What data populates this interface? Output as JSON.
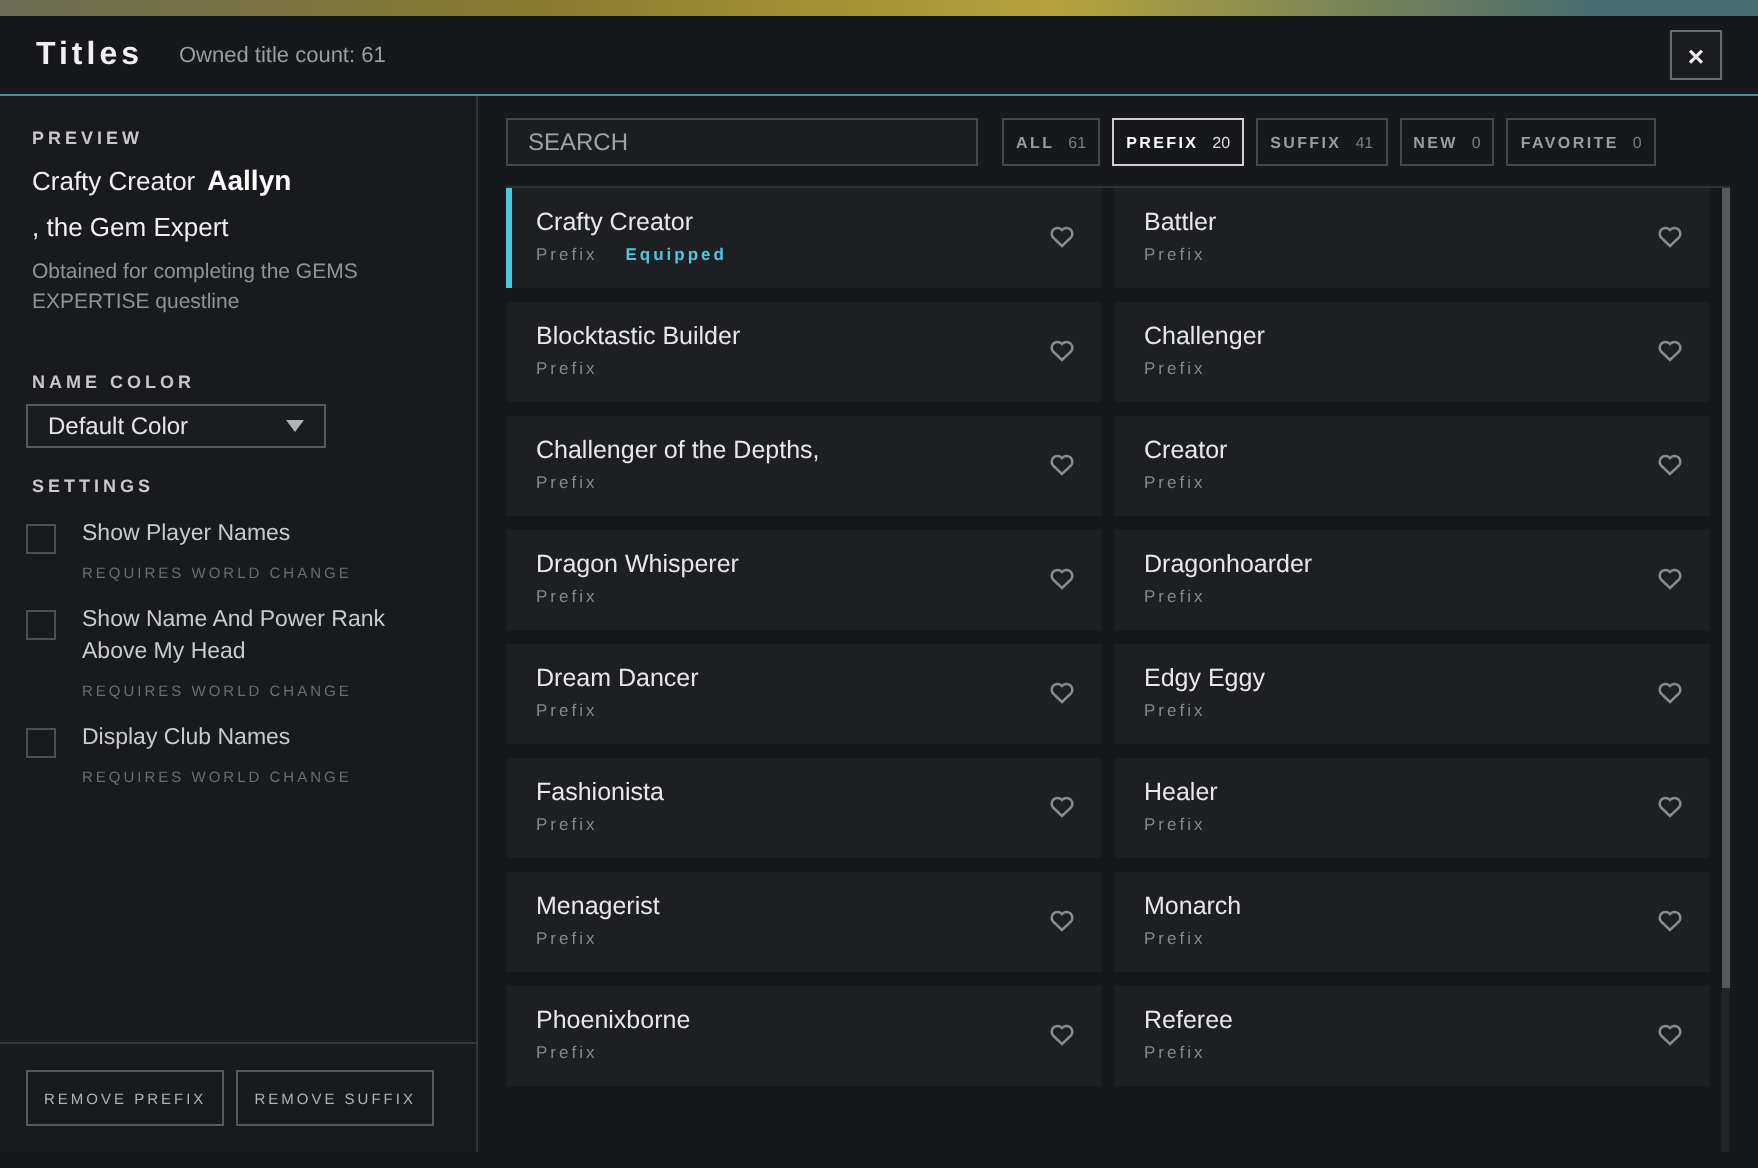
{
  "header": {
    "title": "Titles",
    "subtitle": "Owned title count: 61",
    "close": "×"
  },
  "preview": {
    "label": "PREVIEW",
    "prefix": "Crafty Creator",
    "name": "Aallyn",
    "suffix": ", the Gem Expert",
    "description": "Obtained for completing the GEMS EXPERTISE questline"
  },
  "name_color": {
    "label": "NAME COLOR",
    "value": "Default Color"
  },
  "settings": {
    "label": "SETTINGS",
    "items": [
      {
        "label": "Show Player Names",
        "note": "REQUIRES WORLD CHANGE",
        "checked": false
      },
      {
        "label": "Show Name And Power Rank Above My Head",
        "note": "REQUIRES WORLD CHANGE",
        "checked": false
      },
      {
        "label": "Display Club Names",
        "note": "REQUIRES WORLD CHANGE",
        "checked": false
      }
    ]
  },
  "footer_buttons": [
    "REMOVE PREFIX",
    "REMOVE SUFFIX"
  ],
  "search": {
    "placeholder": "SEARCH"
  },
  "filters": [
    {
      "label": "ALL",
      "count": "61",
      "selected": false
    },
    {
      "label": "PREFIX",
      "count": "20",
      "selected": true
    },
    {
      "label": "SUFFIX",
      "count": "41",
      "selected": false
    },
    {
      "label": "NEW",
      "count": "0",
      "selected": false
    },
    {
      "label": "FAVORITE",
      "count": "0",
      "selected": false
    }
  ],
  "titles": [
    {
      "name": "Crafty Creator",
      "type": "Prefix",
      "status": "Equipped",
      "selected": true,
      "favorite": false
    },
    {
      "name": "Battler",
      "type": "Prefix",
      "selected": false,
      "favorite": false
    },
    {
      "name": "Blocktastic Builder",
      "type": "Prefix",
      "selected": false,
      "favorite": false
    },
    {
      "name": "Challenger",
      "type": "Prefix",
      "selected": false,
      "favorite": false
    },
    {
      "name": "Challenger of the Depths,",
      "type": "Prefix",
      "selected": false,
      "favorite": false
    },
    {
      "name": "Creator",
      "type": "Prefix",
      "selected": false,
      "favorite": false
    },
    {
      "name": "Dragon Whisperer",
      "type": "Prefix",
      "selected": false,
      "favorite": false
    },
    {
      "name": "Dragonhoarder",
      "type": "Prefix",
      "selected": false,
      "favorite": false
    },
    {
      "name": "Dream Dancer",
      "type": "Prefix",
      "selected": false,
      "favorite": false
    },
    {
      "name": "Edgy Eggy",
      "type": "Prefix",
      "selected": false,
      "favorite": false
    },
    {
      "name": "Fashionista",
      "type": "Prefix",
      "selected": false,
      "favorite": false
    },
    {
      "name": "Healer",
      "type": "Prefix",
      "selected": false,
      "favorite": false
    },
    {
      "name": "Menagerist",
      "type": "Prefix",
      "selected": false,
      "favorite": false
    },
    {
      "name": "Monarch",
      "type": "Prefix",
      "selected": false,
      "favorite": false
    },
    {
      "name": "Phoenixborne",
      "type": "Prefix",
      "selected": false,
      "favorite": false
    },
    {
      "name": "Referee",
      "type": "Prefix",
      "selected": false,
      "favorite": false
    }
  ]
}
